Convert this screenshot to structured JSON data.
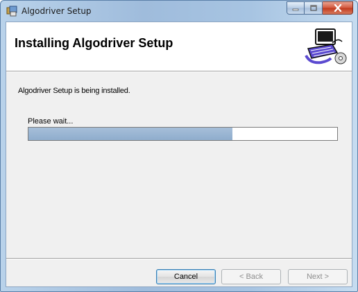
{
  "window": {
    "title": "Algodriver Setup"
  },
  "header": {
    "title": "Installing Algodriver Setup",
    "art_icon": "computer-cd-icon"
  },
  "main": {
    "status": "Algodriver Setup is being installed.",
    "wait_label": "Please wait...",
    "progress_percent": 66
  },
  "buttons": {
    "cancel": "Cancel",
    "back": "< Back",
    "next": "Next >"
  },
  "colors": {
    "progress_fill": "#9cb7d6",
    "close_button": "#c8452a"
  }
}
